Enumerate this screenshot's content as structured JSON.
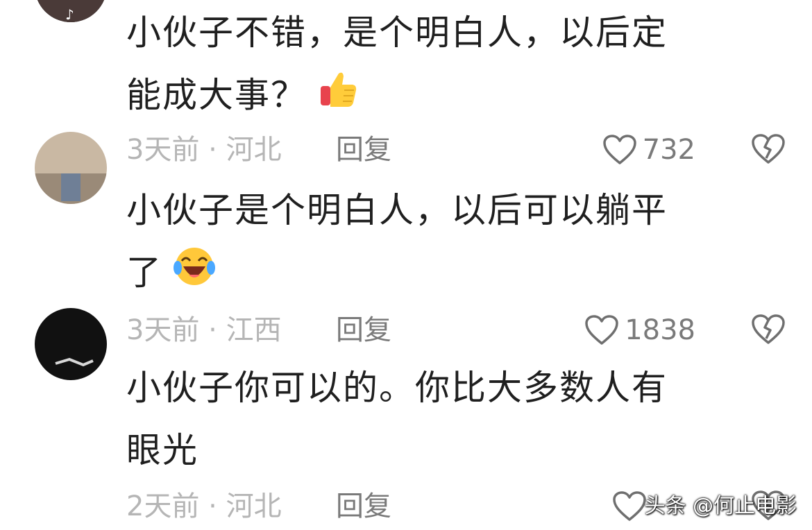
{
  "comments": [
    {
      "text_line1": "小伙子不错，是个明白人，以后定",
      "text_line2": "能成大事？",
      "emoji": "thumbs-up",
      "time": "3天前 · 河北",
      "reply_label": "回复",
      "likes": "732"
    },
    {
      "text_line1": "小伙子是个明白人，以后可以躺平",
      "text_line2": "了",
      "emoji": "crying-laughing-face",
      "time": "3天前 · 江西",
      "reply_label": "回复",
      "likes": "1838"
    },
    {
      "text_line1": "小伙子你可以的。你比大多数人有",
      "text_line2": "眼光",
      "time": "2天前 · 河北",
      "reply_label": "回复"
    }
  ],
  "watermark": "头条 @何止电影",
  "colors": {
    "text": "#1f1f1f",
    "meta": "#b5b5b5",
    "action": "#7a7a7a",
    "background": "#ffffff"
  },
  "icons": {
    "like": "heart-outline-icon",
    "dislike": "broken-heart-icon"
  }
}
